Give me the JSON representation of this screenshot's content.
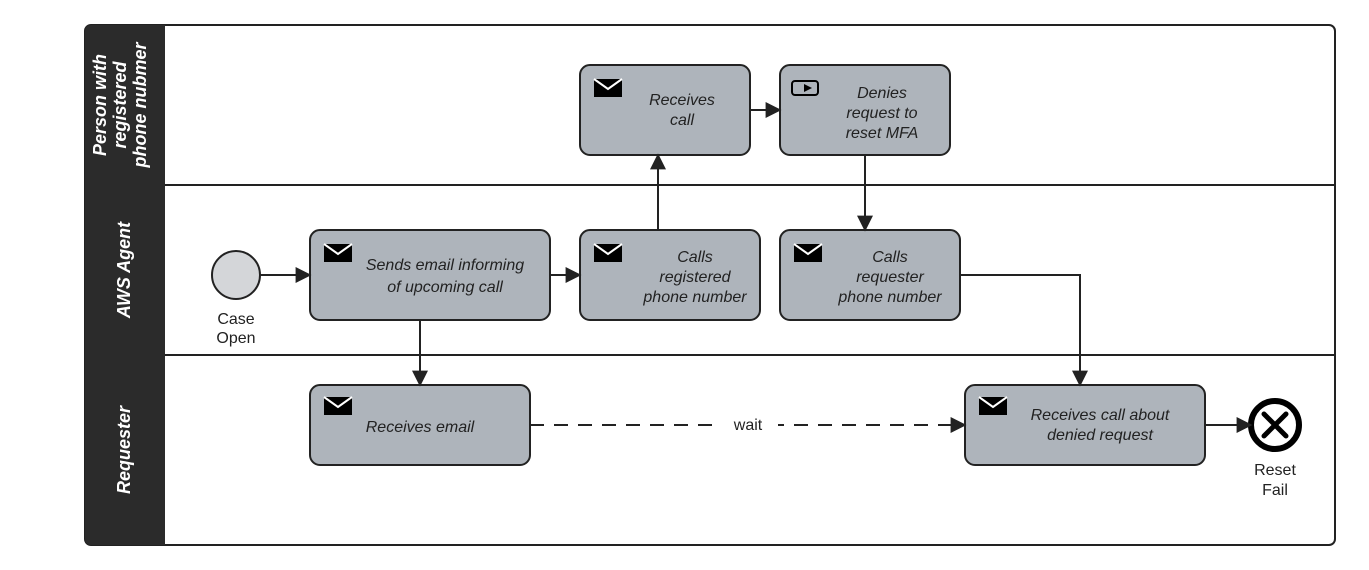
{
  "lanes": {
    "lane1": "Person with registered phone nubmer",
    "lane2": "AWS Agent",
    "lane3": "Requester"
  },
  "nodes": {
    "start_label": "Case Open",
    "sends_email": "Sends email informing of upcoming call",
    "calls_registered": "Calls registered phone number",
    "calls_requester": "Calls requester phone number",
    "receives_call": "Receives call",
    "denies_request": "Denies request to reset MFA",
    "receives_email": "Receives email",
    "receives_call_denied": "Receives call about denied request",
    "end_label1": "Reset",
    "end_label2": "Fail"
  },
  "edges": {
    "wait": "wait"
  },
  "colors": {
    "lane_header": "#2b2b2b",
    "node_fill": "#aeb4bb",
    "start_fill": "#d4d6d9",
    "outline": "#222222"
  }
}
